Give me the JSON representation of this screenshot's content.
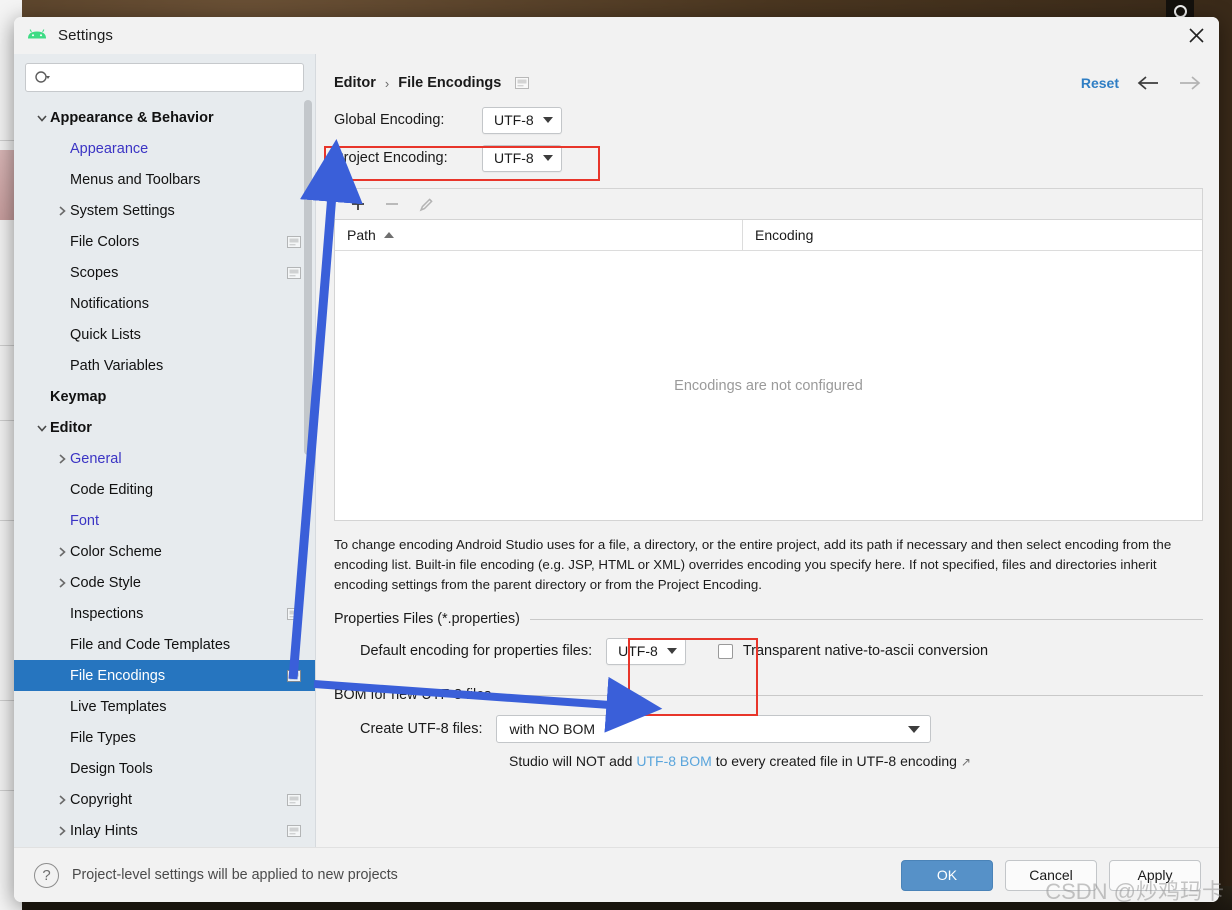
{
  "window": {
    "title": "Settings",
    "app_icon": "android-logo-icon",
    "close_icon": "close-icon"
  },
  "sidebar": {
    "search": {
      "value": "",
      "placeholder": "",
      "icon": "search-icon"
    },
    "items": [
      {
        "label": "Appearance & Behavior",
        "indent": 0,
        "twisty": "chevron-down",
        "bold": true,
        "link": false,
        "config_icon": false,
        "selected": false
      },
      {
        "label": "Appearance",
        "indent": 1,
        "twisty": "none",
        "bold": false,
        "link": true,
        "config_icon": false,
        "selected": false
      },
      {
        "label": "Menus and Toolbars",
        "indent": 1,
        "twisty": "none",
        "bold": false,
        "link": false,
        "config_icon": false,
        "selected": false
      },
      {
        "label": "System Settings",
        "indent": 1,
        "twisty": "chevron-right",
        "bold": false,
        "link": false,
        "config_icon": false,
        "selected": false
      },
      {
        "label": "File Colors",
        "indent": 1,
        "twisty": "none",
        "bold": false,
        "link": false,
        "config_icon": true,
        "selected": false
      },
      {
        "label": "Scopes",
        "indent": 1,
        "twisty": "none",
        "bold": false,
        "link": false,
        "config_icon": true,
        "selected": false
      },
      {
        "label": "Notifications",
        "indent": 1,
        "twisty": "none",
        "bold": false,
        "link": false,
        "config_icon": false,
        "selected": false
      },
      {
        "label": "Quick Lists",
        "indent": 1,
        "twisty": "none",
        "bold": false,
        "link": false,
        "config_icon": false,
        "selected": false
      },
      {
        "label": "Path Variables",
        "indent": 1,
        "twisty": "none",
        "bold": false,
        "link": false,
        "config_icon": false,
        "selected": false
      },
      {
        "label": "Keymap",
        "indent": 0,
        "twisty": "none",
        "bold": true,
        "link": false,
        "config_icon": false,
        "selected": false
      },
      {
        "label": "Editor",
        "indent": 0,
        "twisty": "chevron-down",
        "bold": true,
        "link": false,
        "config_icon": false,
        "selected": false
      },
      {
        "label": "General",
        "indent": 1,
        "twisty": "chevron-right",
        "bold": false,
        "link": true,
        "config_icon": false,
        "selected": false
      },
      {
        "label": "Code Editing",
        "indent": 1,
        "twisty": "none",
        "bold": false,
        "link": false,
        "config_icon": false,
        "selected": false
      },
      {
        "label": "Font",
        "indent": 1,
        "twisty": "none",
        "bold": false,
        "link": true,
        "config_icon": false,
        "selected": false
      },
      {
        "label": "Color Scheme",
        "indent": 1,
        "twisty": "chevron-right",
        "bold": false,
        "link": false,
        "config_icon": false,
        "selected": false
      },
      {
        "label": "Code Style",
        "indent": 1,
        "twisty": "chevron-right",
        "bold": false,
        "link": false,
        "config_icon": false,
        "selected": false
      },
      {
        "label": "Inspections",
        "indent": 1,
        "twisty": "none",
        "bold": false,
        "link": false,
        "config_icon": true,
        "selected": false
      },
      {
        "label": "File and Code Templates",
        "indent": 1,
        "twisty": "none",
        "bold": false,
        "link": false,
        "config_icon": false,
        "selected": false
      },
      {
        "label": "File Encodings",
        "indent": 1,
        "twisty": "none",
        "bold": false,
        "link": false,
        "config_icon": true,
        "selected": true
      },
      {
        "label": "Live Templates",
        "indent": 1,
        "twisty": "none",
        "bold": false,
        "link": false,
        "config_icon": false,
        "selected": false
      },
      {
        "label": "File Types",
        "indent": 1,
        "twisty": "none",
        "bold": false,
        "link": false,
        "config_icon": false,
        "selected": false
      },
      {
        "label": "Design Tools",
        "indent": 1,
        "twisty": "none",
        "bold": false,
        "link": false,
        "config_icon": false,
        "selected": false
      },
      {
        "label": "Copyright",
        "indent": 1,
        "twisty": "chevron-right",
        "bold": false,
        "link": false,
        "config_icon": true,
        "selected": false
      },
      {
        "label": "Inlay Hints",
        "indent": 1,
        "twisty": "chevron-right",
        "bold": false,
        "link": false,
        "config_icon": true,
        "selected": false
      }
    ]
  },
  "content": {
    "breadcrumb": {
      "parent": "Editor",
      "separator": "›",
      "current": "File Encodings",
      "config_icon": "project-level-icon"
    },
    "reset_label": "Reset",
    "back_icon": "arrow-left-icon",
    "forward_icon": "arrow-right-icon",
    "global_encoding": {
      "label": "Global Encoding:",
      "value": "UTF-8"
    },
    "project_encoding": {
      "label": "Project Encoding:",
      "value": "UTF-8"
    },
    "table_toolbar": {
      "add_icon": "plus-icon",
      "remove_icon": "minus-icon",
      "edit_icon": "pencil-icon"
    },
    "table": {
      "columns": [
        "Path",
        "Encoding"
      ],
      "sort_column": "Path",
      "sort_direction": "ascending",
      "rows": [],
      "empty_text": "Encodings are not configured"
    },
    "help_text": "To change encoding Android Studio uses for a file, a directory, or the entire project, add its path if necessary and then select encoding from the encoding list. Built-in file encoding (e.g. JSP, HTML or XML) overrides encoding you specify here. If not specified, files and directories inherit encoding settings from the parent directory or from the Project Encoding.",
    "properties_group": {
      "title": "Properties Files (*.properties)",
      "default_encoding_label": "Default encoding for properties files:",
      "default_encoding_value": "UTF-8",
      "transparent_checkbox_label": "Transparent native-to-ascii conversion",
      "transparent_checked": false
    },
    "bom_group": {
      "title": "BOM for new UTF-8 files",
      "create_label": "Create UTF-8 files:",
      "create_value": "with NO BOM",
      "note_prefix": "Studio will NOT add ",
      "note_link": "UTF-8 BOM",
      "note_suffix": " to every created file in UTF-8 encoding",
      "external_icon": "↗"
    }
  },
  "footer": {
    "help_icon": "?",
    "note": "Project-level settings will be applied to new projects",
    "ok_label": "OK",
    "cancel_label": "Cancel",
    "apply_label": "Apply"
  },
  "annotations": {
    "red_boxes": 2,
    "arrows": 2,
    "arrow_color": "#3a5fd9",
    "box_color": "#e8352a"
  },
  "watermark": {
    "text": "CSDN @炒鸡玛卡"
  },
  "colors": {
    "selection_blue": "#2675bf",
    "primary_button": "#5691c8",
    "link_blue": "#3b34c4",
    "reset_blue": "#2f7ec4",
    "sidebar_bg": "#e7ebee",
    "content_bg": "#f2f2f2"
  }
}
